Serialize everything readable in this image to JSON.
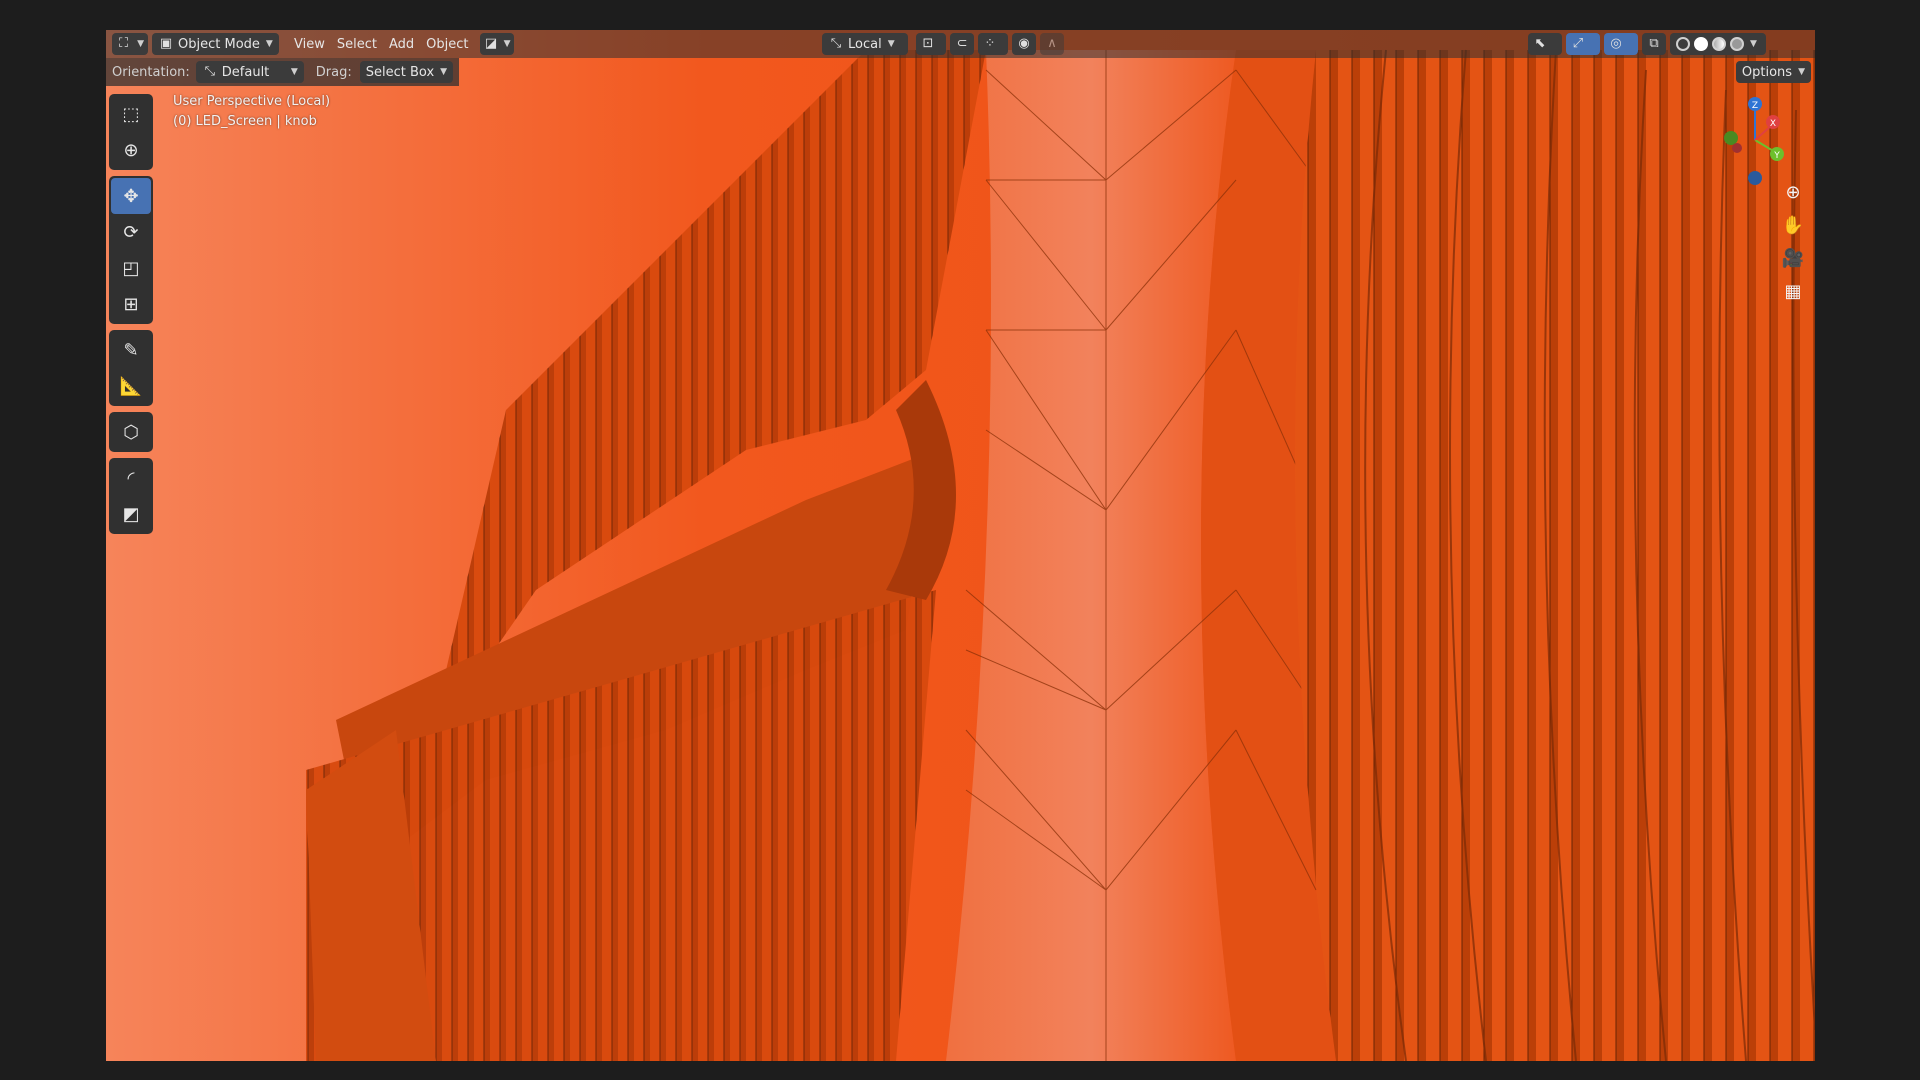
{
  "header": {
    "editor_type_icon": "3d-viewport-icon",
    "mode_label": "Object Mode",
    "menus": [
      "View",
      "Select",
      "Add",
      "Object"
    ],
    "transform_orientation_label": "Local",
    "options_label": "Options"
  },
  "tool_settings": {
    "orientation_label": "Orientation:",
    "orientation_value": "Default",
    "drag_label": "Drag:",
    "drag_value": "Select Box"
  },
  "viewport_info": {
    "line1": "User Perspective (Local)",
    "line2": "(0) LED_Screen | knob"
  },
  "gizmo": {
    "x": "X",
    "y": "Y",
    "z": "Z"
  },
  "tools": [
    "select-box-icon",
    "cursor-icon",
    "move-icon",
    "rotate-icon",
    "scale-icon",
    "transform-icon",
    "annotate-icon",
    "measure-icon",
    "add-cube-icon",
    "shear-icon",
    "inset-icon"
  ],
  "colors": {
    "accent": "#4772b3",
    "object": "#ee4f0e"
  }
}
